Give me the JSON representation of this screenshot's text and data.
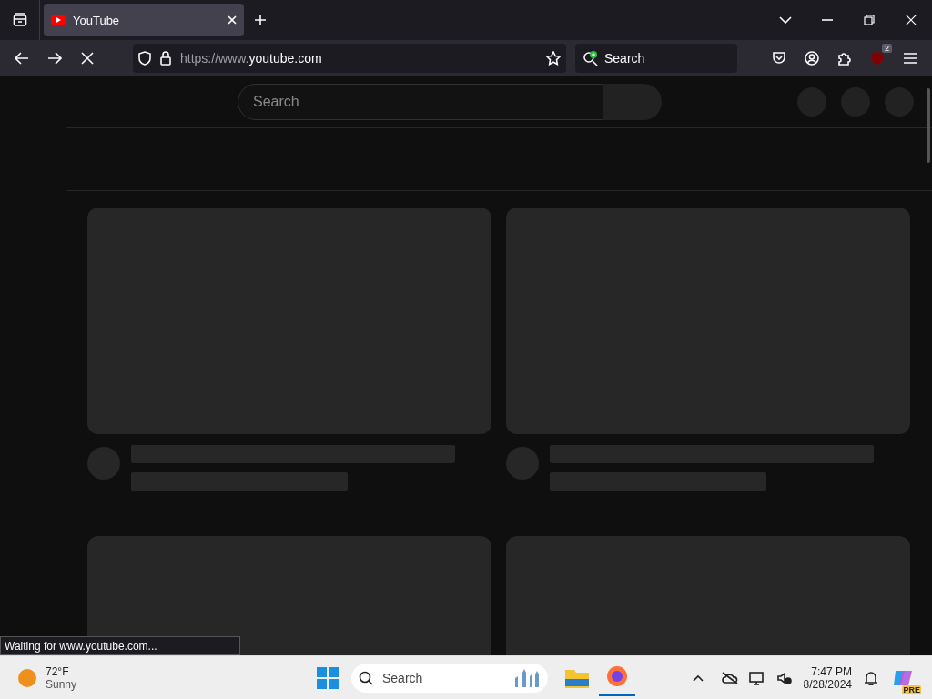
{
  "tabs": [
    {
      "title": "YouTube",
      "selected": true
    }
  ],
  "toolbar": {
    "loading": true,
    "url_prefix": "https://www.",
    "url_host": "youtube.com",
    "search_placeholder": "Search",
    "extension_badge": "2"
  },
  "page": {
    "search_placeholder": "Search",
    "cards": [
      {
        "kind": "skeleton"
      },
      {
        "kind": "skeleton"
      },
      {
        "kind": "thumbnail"
      },
      {
        "kind": "thumbnail"
      }
    ]
  },
  "status_text": "Waiting for www.youtube.com...",
  "taskbar": {
    "temperature": "72°F",
    "condition": "Sunny",
    "search_placeholder": "Search",
    "time": "7:47 PM",
    "date": "8/28/2024",
    "copilot_badge": "PRE"
  }
}
